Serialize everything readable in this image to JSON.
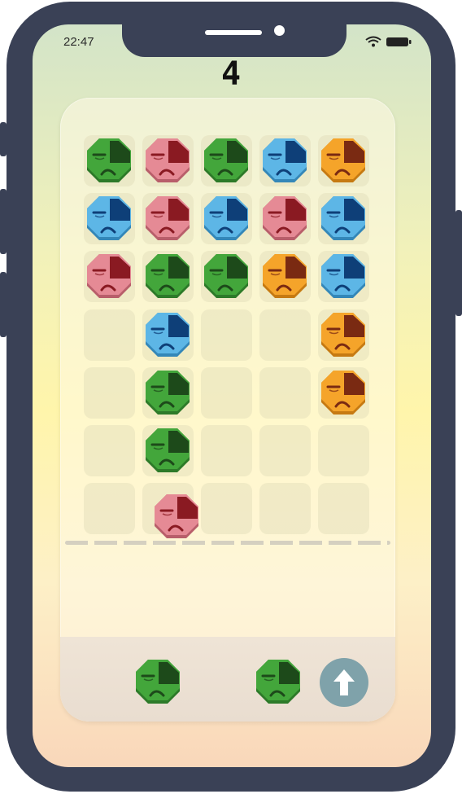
{
  "status_bar": {
    "time": "22:47",
    "icons": [
      "wifi-icon",
      "battery-icon"
    ]
  },
  "game": {
    "score": "4"
  },
  "colors": {
    "green": {
      "face": "#43a63b",
      "dark": "#2d7a29",
      "patch": "#1d4a1a"
    },
    "red": {
      "face": "#e58a95",
      "dark": "#b85e6a",
      "patch": "#8a1a22"
    },
    "blue": {
      "face": "#5db6e6",
      "dark": "#3487b8",
      "patch": "#0e3f78"
    },
    "orange": {
      "face": "#f5a42a",
      "dark": "#c67a12",
      "patch": "#7a2a12"
    }
  },
  "board": {
    "columns": 5,
    "rows": 7,
    "grid": [
      [
        "green",
        "red",
        "green",
        "blue",
        "orange"
      ],
      [
        "blue",
        "red",
        "blue",
        "red",
        "blue"
      ],
      [
        "red",
        "green",
        "green",
        "orange",
        "blue"
      ],
      [
        "",
        "blue",
        "",
        "",
        "orange"
      ],
      [
        "",
        "green",
        "",
        "",
        "orange"
      ],
      [
        "",
        "green",
        "",
        "",
        ""
      ],
      [
        "",
        "",
        "",
        "",
        ""
      ]
    ],
    "falling_piece": {
      "color": "red",
      "column": 1
    }
  },
  "tray": {
    "next_pieces": [
      "green",
      "green"
    ],
    "shoot_button": "arrow-up-icon"
  }
}
